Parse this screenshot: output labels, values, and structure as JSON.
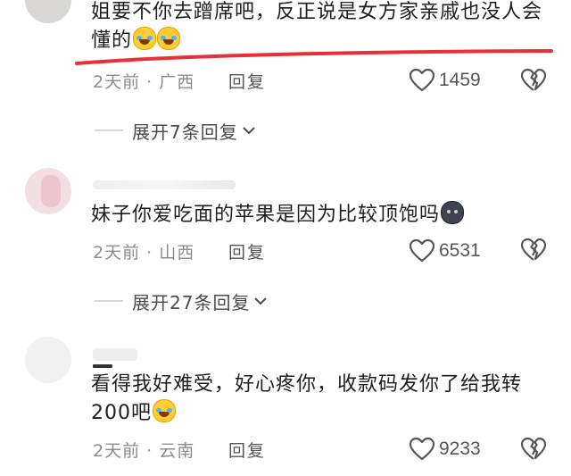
{
  "comments": [
    {
      "text": "姐要不你去蹭席吧，反正说是女方家亲戚也没人会懂的",
      "emojis": [
        "laughing-crying-emoji",
        "laughing-crying-emoji"
      ],
      "meta": "2天前 · 广西",
      "reply_label": "回复",
      "likes": "1459",
      "expand_label": "展开7条回复"
    },
    {
      "text": "妹子你爱吃面的苹果是因为比较顶饱吗",
      "emojis": [
        "dark-face-emoji"
      ],
      "meta": "2天前 · 山西",
      "reply_label": "回复",
      "likes": "6531",
      "expand_label": "展开27条回复"
    },
    {
      "text": "看得我好难受，好心疼你，收款码发你了给我转200吧",
      "emojis": [
        "laughing-crying-emoji"
      ],
      "meta": "2天前 · 云南",
      "reply_label": "回复",
      "likes": "9233"
    }
  ],
  "colors": {
    "annotation_underline": "#e8303a",
    "meta_text": "#8c8c8c",
    "body_text": "#1e1e1e"
  },
  "icons": [
    "heart-outline-icon",
    "broken-heart-icon",
    "chevron-down-icon"
  ]
}
